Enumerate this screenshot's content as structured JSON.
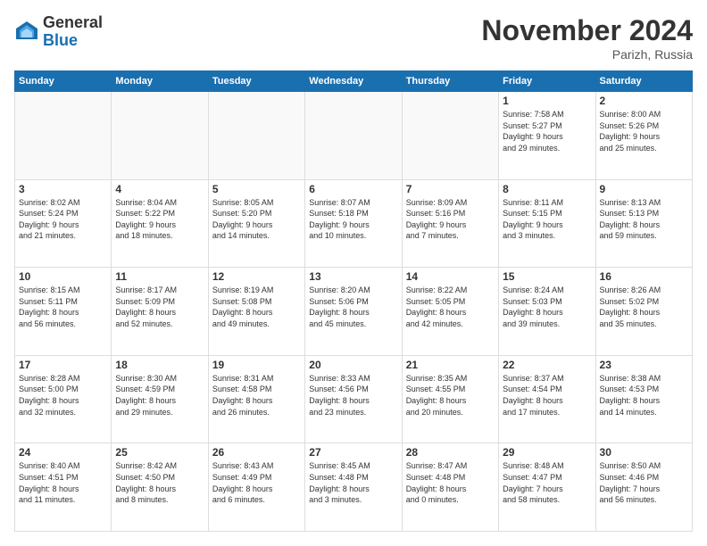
{
  "header": {
    "logo_general": "General",
    "logo_blue": "Blue",
    "month_title": "November 2024",
    "location": "Parizh, Russia"
  },
  "weekdays": [
    "Sunday",
    "Monday",
    "Tuesday",
    "Wednesday",
    "Thursday",
    "Friday",
    "Saturday"
  ],
  "weeks": [
    [
      {
        "day": "",
        "info": ""
      },
      {
        "day": "",
        "info": ""
      },
      {
        "day": "",
        "info": ""
      },
      {
        "day": "",
        "info": ""
      },
      {
        "day": "",
        "info": ""
      },
      {
        "day": "1",
        "info": "Sunrise: 7:58 AM\nSunset: 5:27 PM\nDaylight: 9 hours\nand 29 minutes."
      },
      {
        "day": "2",
        "info": "Sunrise: 8:00 AM\nSunset: 5:26 PM\nDaylight: 9 hours\nand 25 minutes."
      }
    ],
    [
      {
        "day": "3",
        "info": "Sunrise: 8:02 AM\nSunset: 5:24 PM\nDaylight: 9 hours\nand 21 minutes."
      },
      {
        "day": "4",
        "info": "Sunrise: 8:04 AM\nSunset: 5:22 PM\nDaylight: 9 hours\nand 18 minutes."
      },
      {
        "day": "5",
        "info": "Sunrise: 8:05 AM\nSunset: 5:20 PM\nDaylight: 9 hours\nand 14 minutes."
      },
      {
        "day": "6",
        "info": "Sunrise: 8:07 AM\nSunset: 5:18 PM\nDaylight: 9 hours\nand 10 minutes."
      },
      {
        "day": "7",
        "info": "Sunrise: 8:09 AM\nSunset: 5:16 PM\nDaylight: 9 hours\nand 7 minutes."
      },
      {
        "day": "8",
        "info": "Sunrise: 8:11 AM\nSunset: 5:15 PM\nDaylight: 9 hours\nand 3 minutes."
      },
      {
        "day": "9",
        "info": "Sunrise: 8:13 AM\nSunset: 5:13 PM\nDaylight: 8 hours\nand 59 minutes."
      }
    ],
    [
      {
        "day": "10",
        "info": "Sunrise: 8:15 AM\nSunset: 5:11 PM\nDaylight: 8 hours\nand 56 minutes."
      },
      {
        "day": "11",
        "info": "Sunrise: 8:17 AM\nSunset: 5:09 PM\nDaylight: 8 hours\nand 52 minutes."
      },
      {
        "day": "12",
        "info": "Sunrise: 8:19 AM\nSunset: 5:08 PM\nDaylight: 8 hours\nand 49 minutes."
      },
      {
        "day": "13",
        "info": "Sunrise: 8:20 AM\nSunset: 5:06 PM\nDaylight: 8 hours\nand 45 minutes."
      },
      {
        "day": "14",
        "info": "Sunrise: 8:22 AM\nSunset: 5:05 PM\nDaylight: 8 hours\nand 42 minutes."
      },
      {
        "day": "15",
        "info": "Sunrise: 8:24 AM\nSunset: 5:03 PM\nDaylight: 8 hours\nand 39 minutes."
      },
      {
        "day": "16",
        "info": "Sunrise: 8:26 AM\nSunset: 5:02 PM\nDaylight: 8 hours\nand 35 minutes."
      }
    ],
    [
      {
        "day": "17",
        "info": "Sunrise: 8:28 AM\nSunset: 5:00 PM\nDaylight: 8 hours\nand 32 minutes."
      },
      {
        "day": "18",
        "info": "Sunrise: 8:30 AM\nSunset: 4:59 PM\nDaylight: 8 hours\nand 29 minutes."
      },
      {
        "day": "19",
        "info": "Sunrise: 8:31 AM\nSunset: 4:58 PM\nDaylight: 8 hours\nand 26 minutes."
      },
      {
        "day": "20",
        "info": "Sunrise: 8:33 AM\nSunset: 4:56 PM\nDaylight: 8 hours\nand 23 minutes."
      },
      {
        "day": "21",
        "info": "Sunrise: 8:35 AM\nSunset: 4:55 PM\nDaylight: 8 hours\nand 20 minutes."
      },
      {
        "day": "22",
        "info": "Sunrise: 8:37 AM\nSunset: 4:54 PM\nDaylight: 8 hours\nand 17 minutes."
      },
      {
        "day": "23",
        "info": "Sunrise: 8:38 AM\nSunset: 4:53 PM\nDaylight: 8 hours\nand 14 minutes."
      }
    ],
    [
      {
        "day": "24",
        "info": "Sunrise: 8:40 AM\nSunset: 4:51 PM\nDaylight: 8 hours\nand 11 minutes."
      },
      {
        "day": "25",
        "info": "Sunrise: 8:42 AM\nSunset: 4:50 PM\nDaylight: 8 hours\nand 8 minutes."
      },
      {
        "day": "26",
        "info": "Sunrise: 8:43 AM\nSunset: 4:49 PM\nDaylight: 8 hours\nand 6 minutes."
      },
      {
        "day": "27",
        "info": "Sunrise: 8:45 AM\nSunset: 4:48 PM\nDaylight: 8 hours\nand 3 minutes."
      },
      {
        "day": "28",
        "info": "Sunrise: 8:47 AM\nSunset: 4:48 PM\nDaylight: 8 hours\nand 0 minutes."
      },
      {
        "day": "29",
        "info": "Sunrise: 8:48 AM\nSunset: 4:47 PM\nDaylight: 7 hours\nand 58 minutes."
      },
      {
        "day": "30",
        "info": "Sunrise: 8:50 AM\nSunset: 4:46 PM\nDaylight: 7 hours\nand 56 minutes."
      }
    ]
  ]
}
